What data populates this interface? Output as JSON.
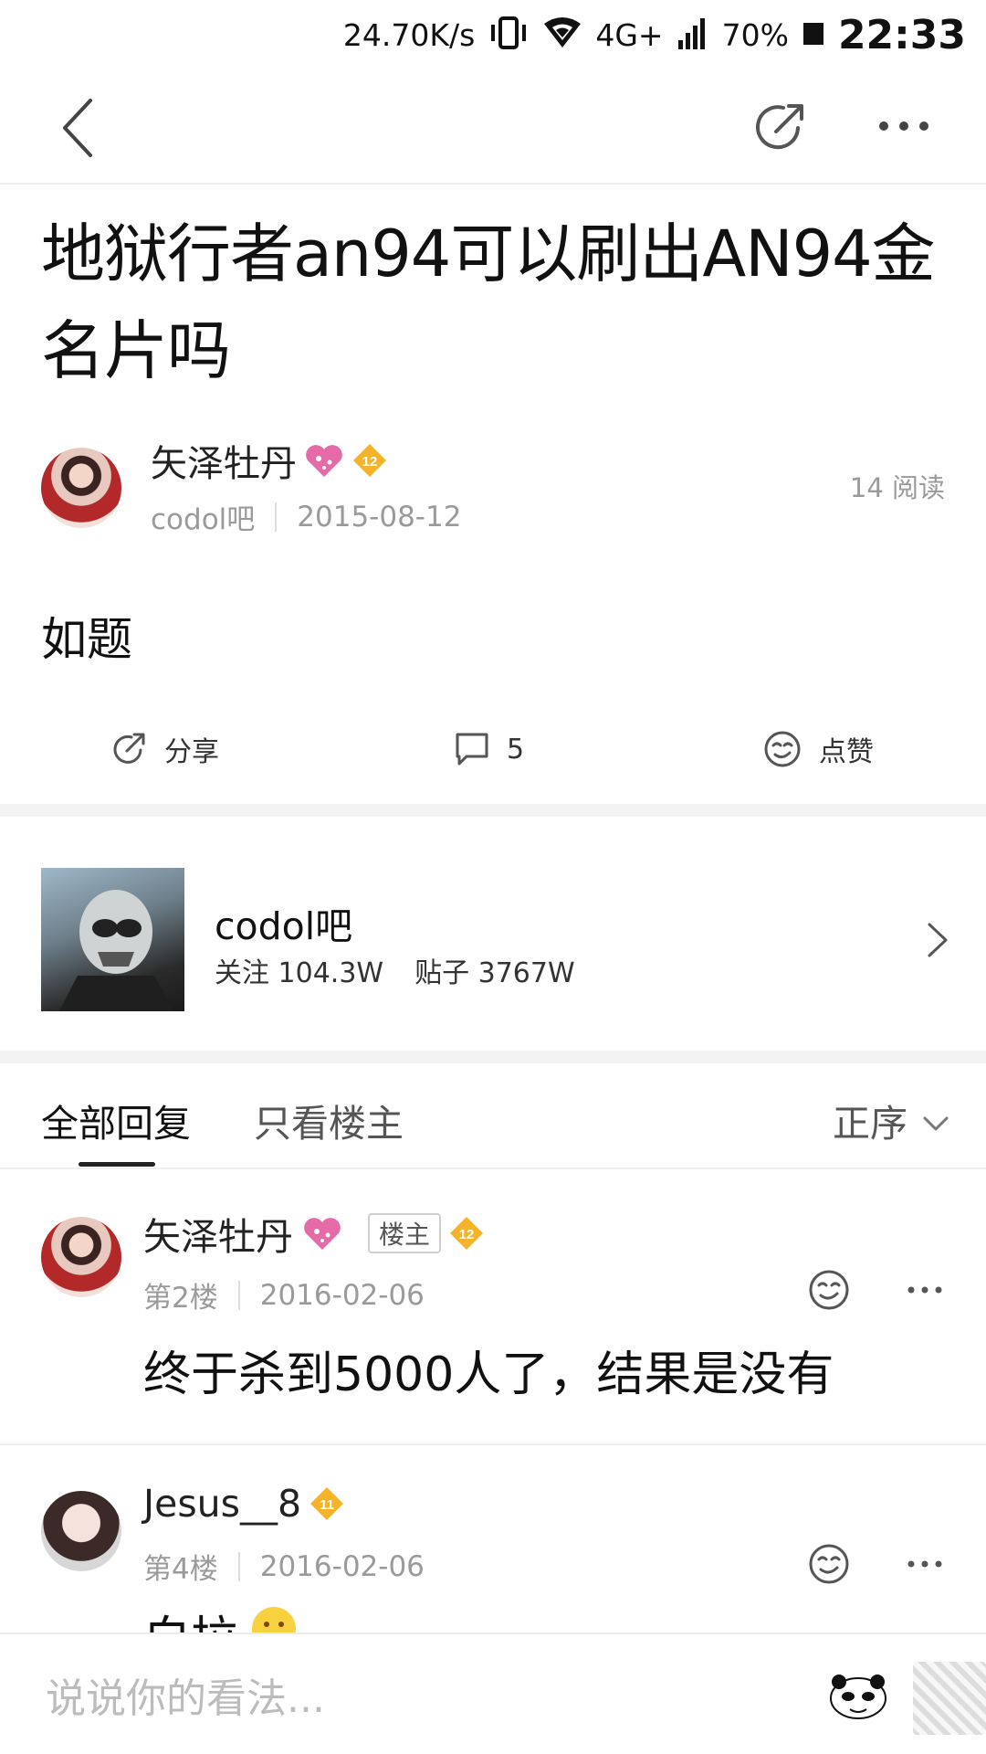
{
  "status_bar": {
    "net_speed": "24.70K/s",
    "network": "4G+",
    "battery": "70%",
    "time": "22:33"
  },
  "nav": {
    "back_icon": "back-chevron-icon",
    "share_icon": "share-icon",
    "more_icon": "more-dots-icon"
  },
  "post": {
    "title": "地狱行者an94可以刷出AN94金名片吗",
    "author": "矢泽牡丹",
    "author_level": "12",
    "forum": "codol吧",
    "date": "2015-08-12",
    "read_count": "14 阅读",
    "body": "如题"
  },
  "actions": {
    "share_label": "分享",
    "comment_count": "5",
    "like_label": "点赞"
  },
  "forum_card": {
    "name": "codol吧",
    "followers": "关注 104.3W",
    "posts": "贴子 3767W"
  },
  "tabs": {
    "all_replies": "全部回复",
    "op_only": "只看楼主",
    "sort": "正序"
  },
  "replies": [
    {
      "author": "矢泽牡丹",
      "op_tag": "楼主",
      "level": "12",
      "floor": "第2楼",
      "date": "2016-02-06",
      "content": "终于杀到5000人了，结果是没有"
    },
    {
      "author": "Jesus__8",
      "level": "11",
      "floor": "第4楼",
      "date": "2016-02-06",
      "content": "白拉"
    }
  ],
  "composer": {
    "placeholder": "说说你的看法..."
  }
}
